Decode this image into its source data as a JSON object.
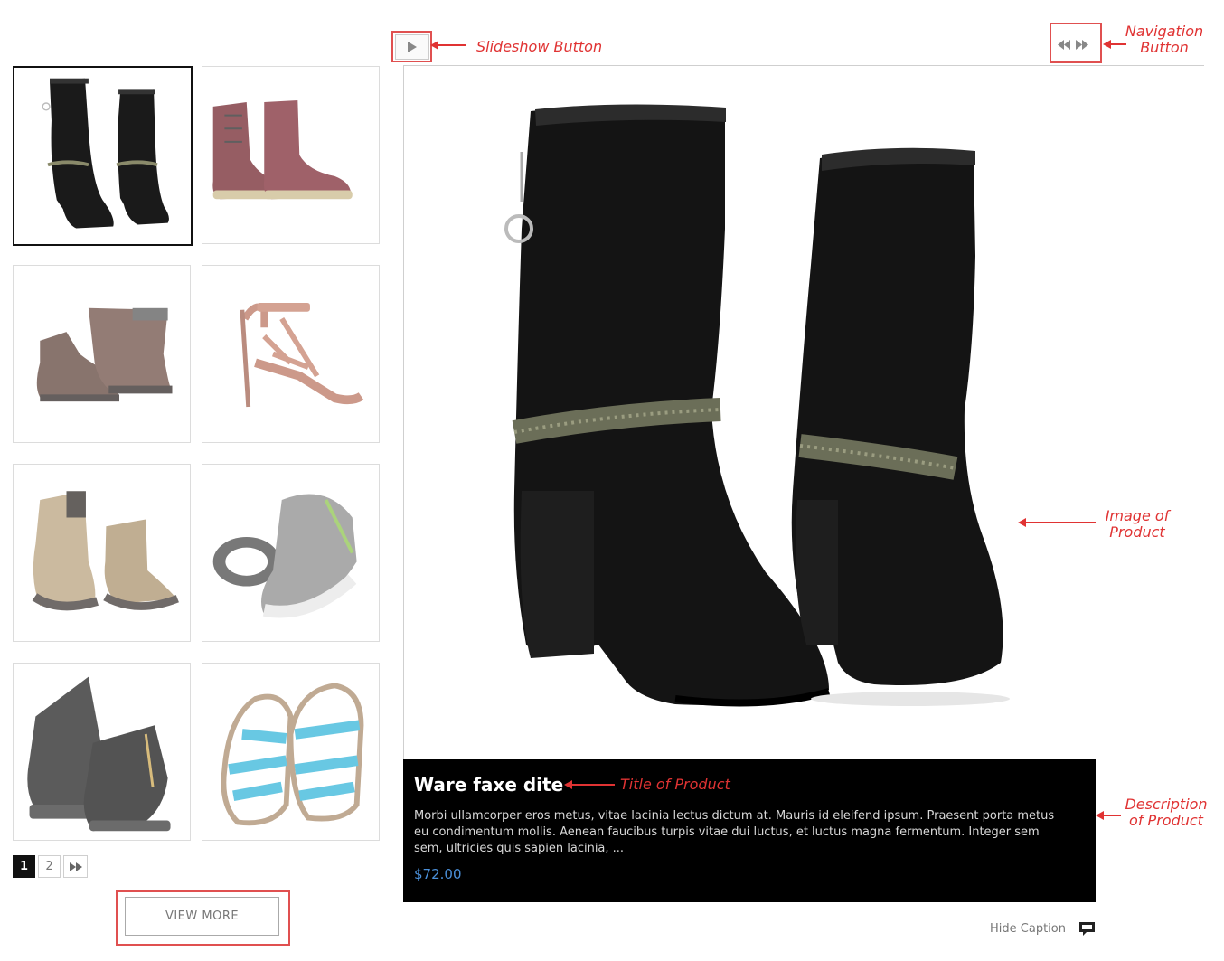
{
  "annotations": {
    "slideshow": "Slideshow Button",
    "navigation": "Navigation Button",
    "image": "Image of Product",
    "title": "Title of Product",
    "description": "Description of Product"
  },
  "annotation_lines": {
    "navigation": [
      "Navigation",
      "Button"
    ],
    "image": [
      "Image of",
      "Product"
    ],
    "description": [
      "Description",
      "of Product"
    ]
  },
  "gallery": {
    "thumbnails": [
      {
        "icon": "black-suede-boot-icon",
        "active": true
      },
      {
        "icon": "burgundy-lace-boot-icon",
        "active": false
      },
      {
        "icon": "brown-leather-boot-icon",
        "active": false
      },
      {
        "icon": "strappy-heel-sandal-icon",
        "active": false
      },
      {
        "icon": "tan-ankle-boot-icon",
        "active": false
      },
      {
        "icon": "gray-sneaker-icon",
        "active": false
      },
      {
        "icon": "black-zip-boot-icon",
        "active": false
      },
      {
        "icon": "blue-sandal-icon",
        "active": false
      }
    ],
    "pager": {
      "pages": [
        "1",
        "2"
      ],
      "current": "1",
      "next_icon": "fast-forward-icon"
    },
    "view_more_label": "VIEW MORE"
  },
  "viewer": {
    "slideshow_icon": "play-icon",
    "nav_icons": [
      "rewind-icon",
      "fast-forward-icon"
    ],
    "caption": {
      "title": "Ware faxe dite",
      "description": "Morbi ullamcorper eros metus, vitae lacinia lectus dictum at. Mauris id eleifend ipsum. Praesent porta metus eu condimentum mollis. Aenean faucibus turpis vitae dui luctus, et luctus magna fermentum. Integer sem sem, ultricies quis sapien lacinia, ...",
      "price": "$72.00"
    },
    "hide_caption_label": "Hide Caption",
    "hide_caption_icon": "speech-bubble-icon"
  },
  "colors": {
    "accent_red": "#e03333",
    "price_blue": "#4a8fd8",
    "caption_bg": "#000000"
  }
}
